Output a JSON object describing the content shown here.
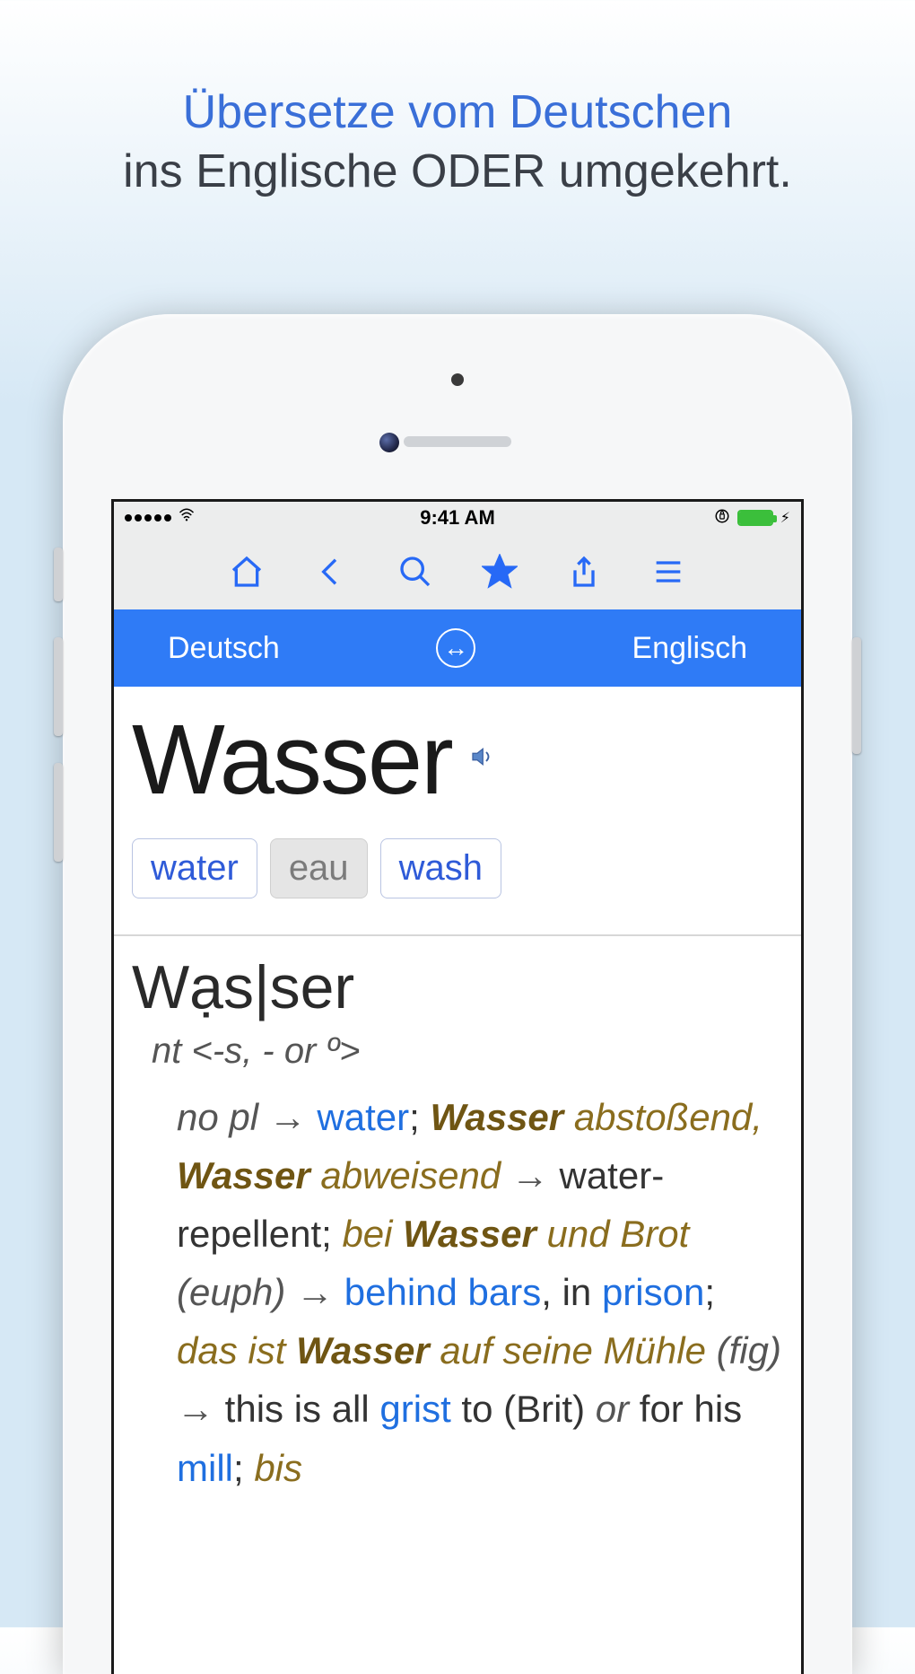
{
  "promo": {
    "line1": "Übersetze vom Deutschen",
    "line2": "ins Englische ODER umgekehrt."
  },
  "statusbar": {
    "time": "9:41 AM",
    "lock_glyph": "⊕",
    "bolt_glyph": "✦"
  },
  "toolbar": {
    "home": "home-icon",
    "back": "back-icon",
    "search": "search-icon",
    "favorite": "star-icon",
    "share": "share-icon",
    "menu": "menu-icon"
  },
  "langbar": {
    "source": "Deutsch",
    "target": "Englisch",
    "swap_glyph": "↔"
  },
  "entry": {
    "headword": "Wasser",
    "chips": [
      "water",
      "eau",
      "wash"
    ],
    "syllab": "Wạs|ser",
    "gram": "nt <-s, - or º>",
    "body": {
      "p1_it1": "no pl",
      "p1_arrow": "→",
      "p1_link1": "water",
      "p1_sep": "; ",
      "p1_deb1": "Wasser",
      "p2_dei1": "abstoßend,",
      "p2_deb1": "Wasser",
      "p2_dei2": "abweisend",
      "p3_arrow": "→",
      "p3_txt": " water-repellent; ",
      "p3_dei1": "bei ",
      "p3_deb1": "Wasser",
      "p4_dei1": "und Brot",
      "p4_it1": " (euph) ",
      "p4_arrow": "→",
      "p4_link1": " behind bars",
      "p4_comma": ",",
      "p5_txt1": "in ",
      "p5_link1": "prison",
      "p5_sep": "; ",
      "p5_dei1": "das ist ",
      "p5_deb1": "Wasser",
      "p5_dei2": " auf",
      "p6_dei1": "seine Mühle",
      "p6_it1": " (fig) ",
      "p6_arrow": "→",
      "p6_txt": " this is all ",
      "p6_link1": "grist",
      "p7_txt1": "to (Brit) ",
      "p7_it1": " or ",
      "p7_txt2": "for his ",
      "p7_link1": "mill",
      "p7_sep": "; ",
      "p7_dei1": "bis"
    }
  }
}
